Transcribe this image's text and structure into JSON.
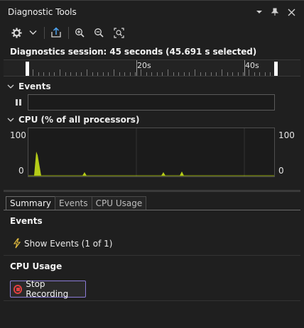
{
  "window": {
    "title": "Diagnostic Tools"
  },
  "session": {
    "text": "Diagnostics session: 45 seconds (45.691 s selected)"
  },
  "ruler": {
    "labels": [
      "20s",
      "40s"
    ]
  },
  "events_section": {
    "label": "Events"
  },
  "cpu_section": {
    "label": "CPU (% of all processors)",
    "y_max": "100",
    "y_min": "0"
  },
  "tabs": [
    {
      "label": "Summary",
      "active": true
    },
    {
      "label": "Events",
      "active": false
    },
    {
      "label": "CPU Usage",
      "active": false
    }
  ],
  "summary": {
    "events_heading": "Events",
    "show_events": "Show Events (1 of 1)",
    "cpu_heading": "CPU Usage",
    "stop_recording": "Stop Recording"
  },
  "colors": {
    "cpu_fill": "#b5cc18",
    "record": "#e04040",
    "button_border": "#8c7cd8"
  },
  "icons": [
    "dropdown-icon",
    "pin-icon",
    "close-icon",
    "gear-icon",
    "chevron-down-icon",
    "export-icon",
    "zoom-in-icon",
    "zoom-out-icon",
    "reset-zoom-icon",
    "pause-icon",
    "lightning-icon",
    "record-stop-icon"
  ]
}
